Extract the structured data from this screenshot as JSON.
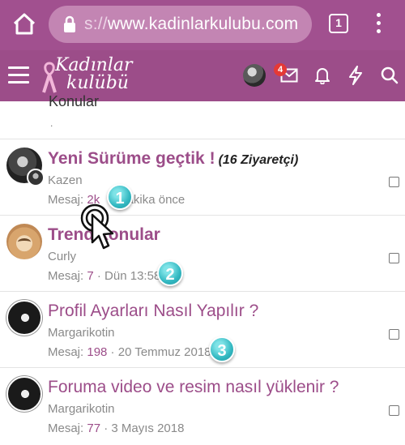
{
  "browser": {
    "url_dim": "s://",
    "url_main": "www.kadinlarkulubu.com",
    "tab_count": "1"
  },
  "site": {
    "logo_line1": "Kadınlar",
    "logo_line2": "kulübü",
    "mail_badge_count": "4"
  },
  "section": {
    "partial_heading": "Konular",
    "partial_dot": "."
  },
  "threads": [
    {
      "title": "Yeni Sürüme geçtik !",
      "title_suffix": "(16 Ziyaretçi)",
      "author": "Kazen",
      "meta_label": "Mesaj:",
      "meta_count": "2k",
      "meta_sep": " · ",
      "meta_time": "dakika önce"
    },
    {
      "title": "Trend konular",
      "author": "Curly",
      "meta_label": "Mesaj:",
      "meta_count": "7",
      "meta_sep": " · ",
      "meta_time": "Dün 13:58"
    },
    {
      "title": "Profil Ayarları Nasıl Yapılır ?",
      "author": "Margarikotin",
      "meta_label": "Mesaj:",
      "meta_count": "198",
      "meta_sep": " · ",
      "meta_time": "20 Temmuz 2018"
    },
    {
      "title": "Foruma video ve resim nasıl yüklenir ?",
      "author": "Margarikotin",
      "meta_label": "Mesaj:",
      "meta_count": "77",
      "meta_sep": " · ",
      "meta_time": "3 Mayıs 2018"
    }
  ],
  "steps": [
    "1",
    "2",
    "3"
  ],
  "colors": {
    "browser_bar": "#a1508f",
    "header": "#9c4d89",
    "accent_link": "#9c4d89",
    "step_badge": "#33b8c1",
    "notification_badge": "#e53935"
  }
}
